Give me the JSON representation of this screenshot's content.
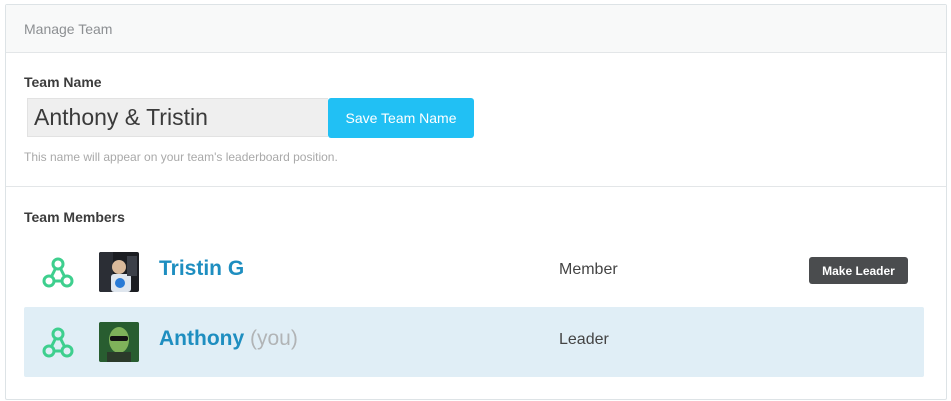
{
  "header": {
    "title": "Manage Team"
  },
  "team_name": {
    "label": "Team Name",
    "value": "Anthony & Tristin",
    "save_label": "Save Team Name",
    "hint": "This name will appear on your team's leaderboard position."
  },
  "members_section": {
    "label": "Team Members",
    "members": [
      {
        "name": "Tristin G",
        "you": "",
        "role": "Member",
        "action": "Make Leader",
        "highlighted": false
      },
      {
        "name": "Anthony",
        "you": "(you)",
        "role": "Leader",
        "action": "",
        "highlighted": true
      }
    ]
  },
  "colors": {
    "accent": "#21c0f4",
    "link": "#1e8ec0",
    "team_icon": "#3ecf8e",
    "highlight_row": "#e0eef6",
    "dark_button": "#4a4c4e"
  },
  "icons": {
    "team": "team-network-icon"
  }
}
